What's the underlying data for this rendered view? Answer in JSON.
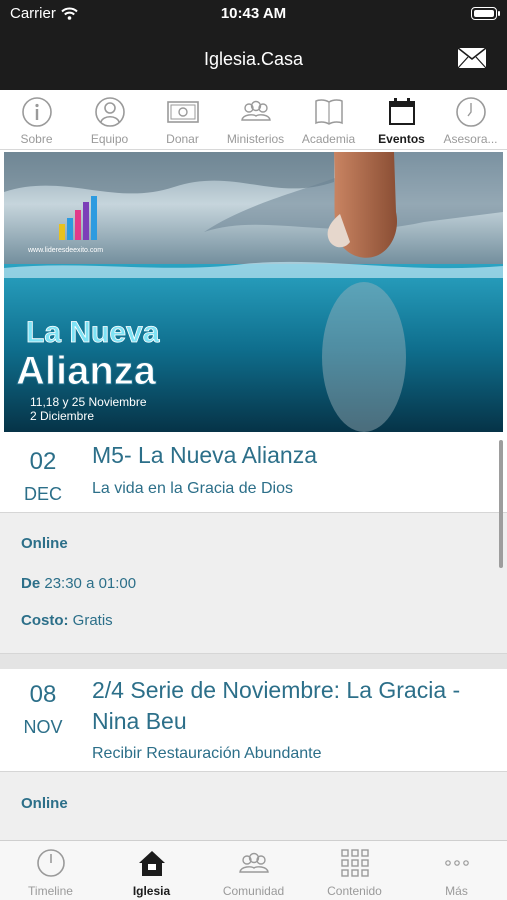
{
  "status": {
    "carrier": "Carrier",
    "time": "10:43 AM"
  },
  "nav": {
    "title": "Iglesia.Casa"
  },
  "top_menu": [
    {
      "label": "Sobre",
      "icon": "info-icon"
    },
    {
      "label": "Equipo",
      "icon": "person-icon"
    },
    {
      "label": "Donar",
      "icon": "money-icon"
    },
    {
      "label": "Ministerios",
      "icon": "group-icon"
    },
    {
      "label": "Academia",
      "icon": "book-icon"
    },
    {
      "label": "Eventos",
      "icon": "calendar-icon",
      "active": true
    },
    {
      "label": "Asesora...",
      "icon": "clock-icon"
    }
  ],
  "banner": {
    "url": "www.lideresdeexito.com",
    "title_line1": "La Nueva",
    "title_line2": "Alianza",
    "dates_line1": "11,18 y 25 Noviembre",
    "dates_line2": "2 Diciembre"
  },
  "events": [
    {
      "day": "02",
      "month": "DEC",
      "title": "M5- La Nueva Alianza",
      "subtitle": "La vida en la Gracia de Dios",
      "location": "Online",
      "time_label": "De",
      "time_value": "23:30 a 01:00",
      "cost_label": "Costo:",
      "cost_value": "Gratis"
    },
    {
      "day": "08",
      "month": "NOV",
      "title": "2/4 Serie de Noviembre: La Gracia - Nina Beu",
      "subtitle": "Recibir Restauración Abundante",
      "location": "Online"
    }
  ],
  "tab_bar": [
    {
      "label": "Timeline",
      "icon": "clock-icon"
    },
    {
      "label": "Iglesia",
      "icon": "home-icon",
      "active": true
    },
    {
      "label": "Comunidad",
      "icon": "group-icon"
    },
    {
      "label": "Contenido",
      "icon": "grid-icon"
    },
    {
      "label": "Más",
      "icon": "more-icon"
    }
  ],
  "colors": {
    "accent": "#2c6f89",
    "bar": "#1c1c1c"
  }
}
